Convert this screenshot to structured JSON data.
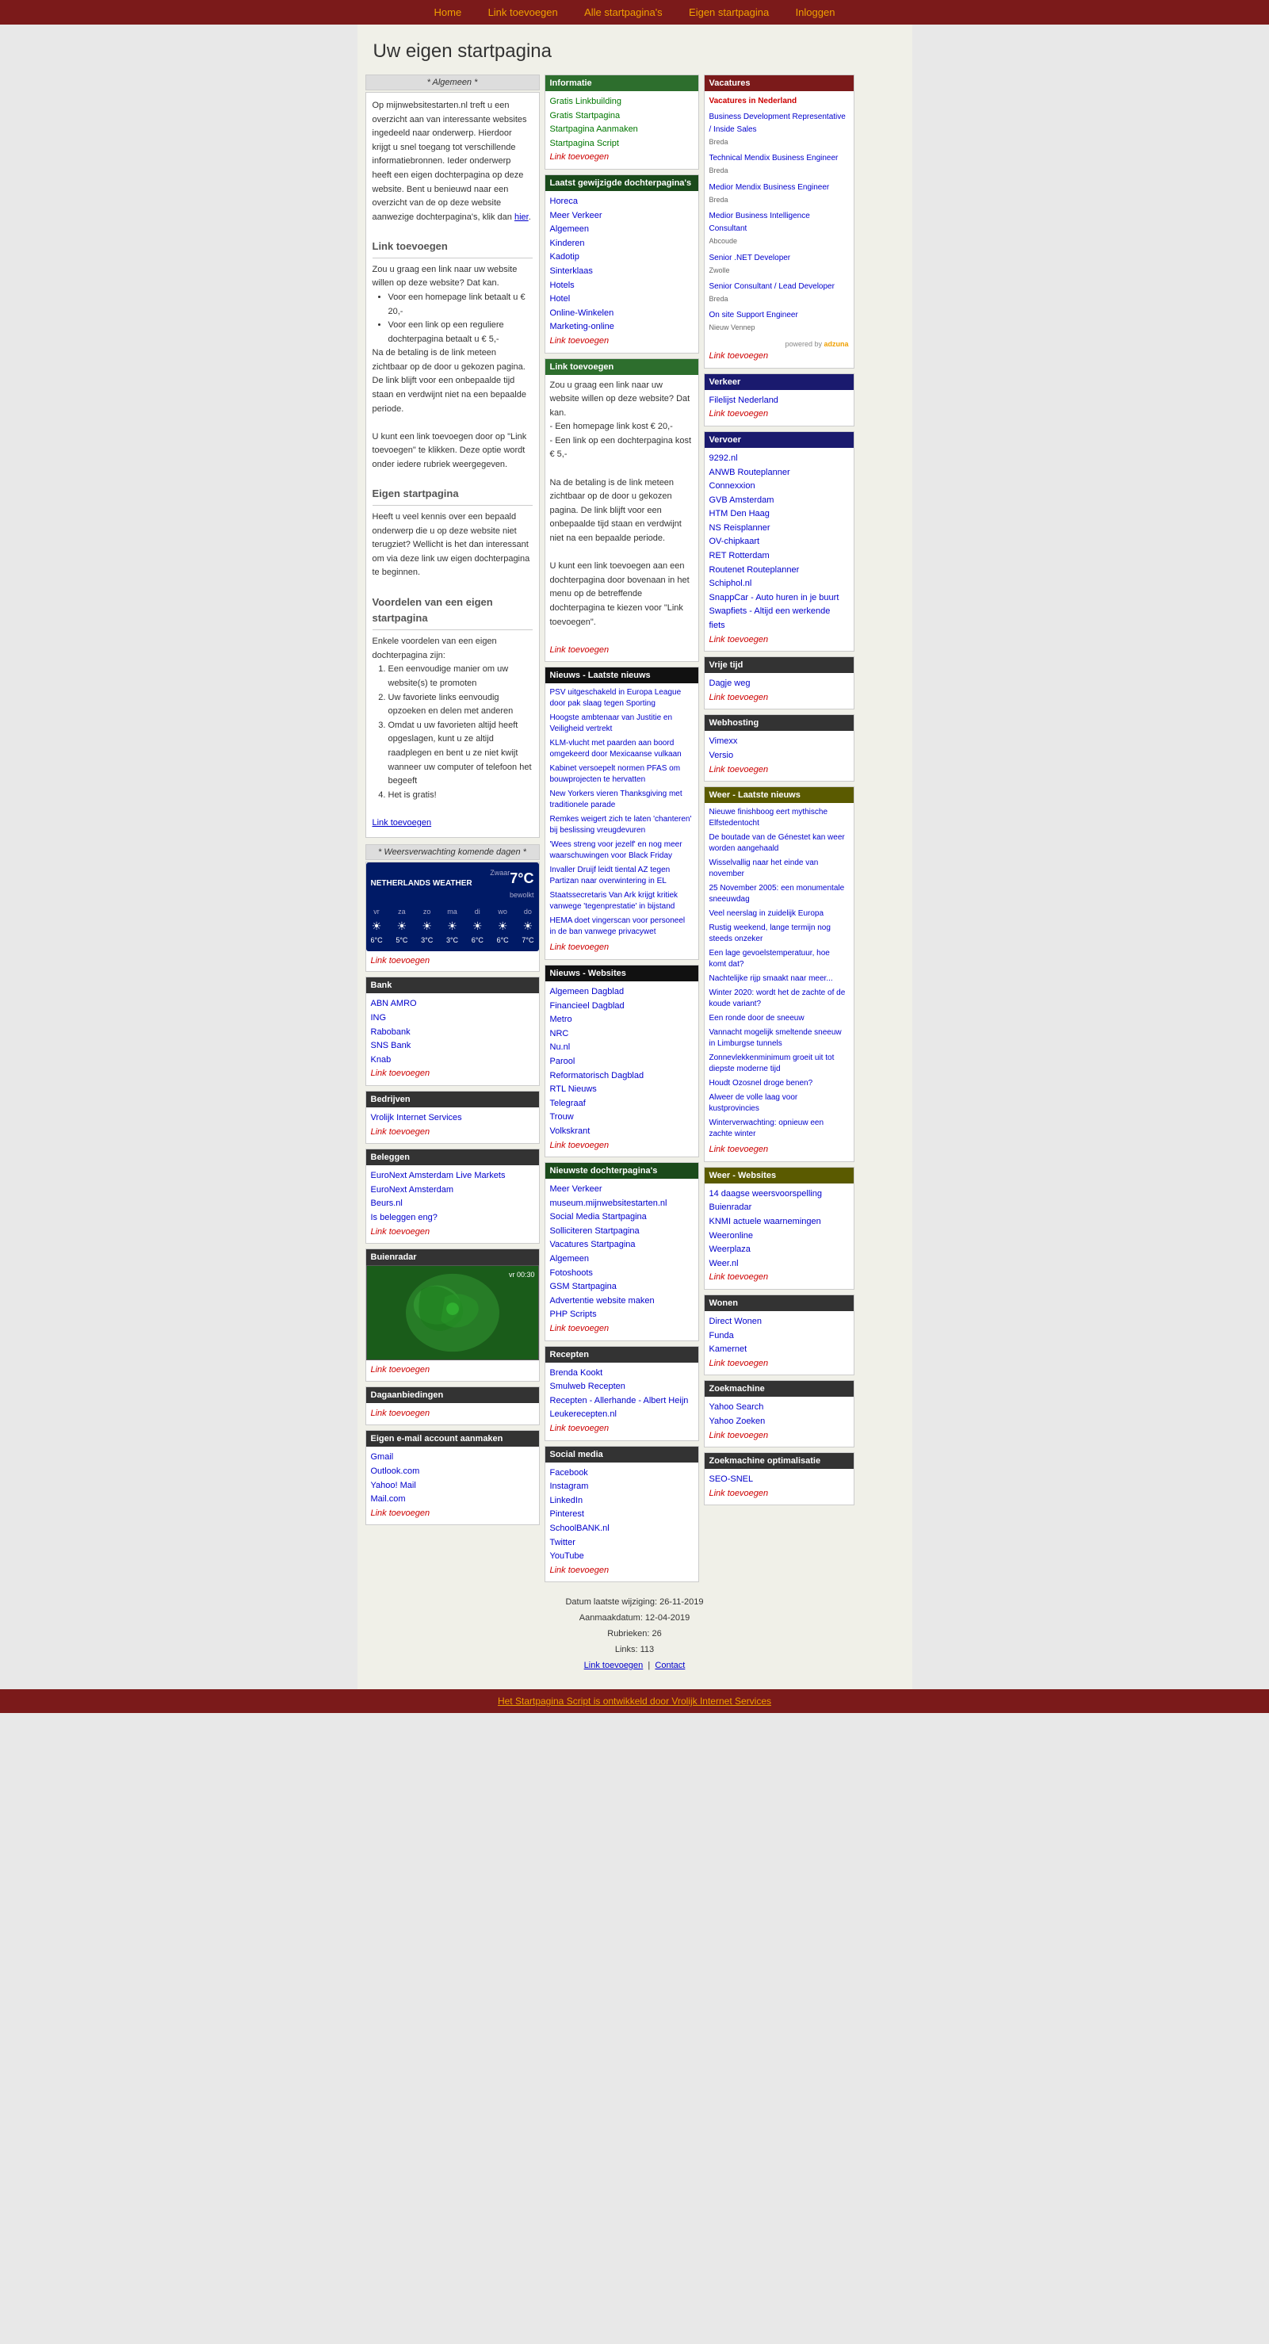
{
  "nav": {
    "items": [
      {
        "label": "Home",
        "url": "#"
      },
      {
        "label": "Link toevoegen",
        "url": "#"
      },
      {
        "label": "Alle startpagina's",
        "url": "#"
      },
      {
        "label": "Eigen startpagina",
        "url": "#"
      },
      {
        "label": "Inloggen",
        "url": "#"
      }
    ]
  },
  "page": {
    "title": "Uw eigen startpagina"
  },
  "algemeen": {
    "header": "* Algemeen *",
    "body1": "Op mijnwebsitestarten.nl treft u een overzicht aan van interessante websites ingedeeld naar onderwerp. Hierdoor krijgt u snel toegang tot verschillende informatiebronnen. Ieder onderwerp heeft een eigen dochterpagina op deze website. Bent u benieuwd naar een overzicht van de op deze website aanwezige dochterpagina's, klik dan",
    "here_text": "hier",
    "link_toevoegen_header": "Link toevoegen",
    "link_body1": "Zou u graag een link naar uw website willen op deze website? Dat kan.",
    "bullet1": "Voor een homepage link betaalt u € 20,-",
    "bullet2": "Voor een link op een reguliere dochterpagina betaalt u € 5,-",
    "link_body2": "Na de betaling is de link meteen zichtbaar op de door u gekozen pagina. De link blijft voor een onbepaalde tijd staan en verdwijnt niet na een bepaalde periode.",
    "link_body3": "U kunt een link toevoegen door op \"Link toevoegen\" te klikken. Deze optie wordt onder iedere rubriek weergegeven.",
    "eigen_header": "Eigen startpagina",
    "eigen_body": "Heeft u veel kennis over een bepaald onderwerp die u op deze website niet terugziet? Wellicht is het dan interessant om via deze link uw eigen dochterpagina te beginnen.",
    "voordelen_header": "Voordelen van een eigen startpagina",
    "voordelen_intro": "Enkele voordelen van een eigen dochterpagina zijn:",
    "voordelen": [
      "Een eenvoudige manier om uw website(s) te promoten",
      "Uw favoriete links eenvoudig opzoeken en delen met anderen",
      "Omdat u uw favorieten altijd heeft opgeslagen, kunt u ze altijd raadplegen en bent u ze niet kwijt wanneer uw computer of telefoon het begeeft",
      "Het is gratis!"
    ],
    "link_toevoegen": "Link toevoegen"
  },
  "weer_header": "* Weersverwachting komende dagen *",
  "weather": {
    "title": "NETHERLANDS WEATHER",
    "temp": "7°C",
    "condition": "Zwaar bewolkt",
    "days": [
      {
        "name": "vr",
        "icon": "☀️",
        "temp": "6°C"
      },
      {
        "name": "za",
        "icon": "☀️",
        "temp": "5°C"
      },
      {
        "name": "zo",
        "icon": "☀️",
        "temp": "3°C"
      },
      {
        "name": "ma",
        "icon": "☀️",
        "temp": "3°C"
      },
      {
        "name": "di",
        "icon": "☀️",
        "temp": "6°C"
      },
      {
        "name": "wo",
        "icon": "☀️",
        "temp": "6°C"
      },
      {
        "name": "do",
        "icon": "☀️",
        "temp": "7°C"
      }
    ],
    "link": "Link toevoegen"
  },
  "bank": {
    "header": "Bank",
    "links": [
      "ABN AMRO",
      "ING",
      "Rabobank",
      "SNS Bank",
      "Knab"
    ],
    "link_toevoegen": "Link toevoegen"
  },
  "bedrijven": {
    "header": "Bedrijven",
    "links": [
      "Vrolijk Internet Services"
    ],
    "link_toevoegen": "Link toevoegen"
  },
  "beleggen": {
    "header": "Beleggen",
    "links": [
      "EuroNext Amsterdam Live Markets",
      "EuroNext Amsterdam",
      "Beurs.nl",
      "Is beleggen eng?"
    ],
    "link_toevoegen": "Link toevoegen"
  },
  "buienradar": {
    "header": "Buienradar",
    "time": "vr 00:30",
    "link_toevoegen": "Link toevoegen"
  },
  "dagaanbiedingen": {
    "header": "Dagaanbiedingen",
    "link_toevoegen": "Link toevoegen"
  },
  "email": {
    "header": "Eigen e-mail account aanmaken",
    "links": [
      "Gmail",
      "Outlook.com",
      "Yahoo! Mail",
      "Mail.com"
    ],
    "link_toevoegen": "Link toevoegen"
  },
  "informatie": {
    "header": "Informatie",
    "links": [
      "Gratis Linkbuilding",
      "Gratis Startpagina",
      "Startpagina Aanmaken",
      "Startpagina Script"
    ],
    "link_toevoegen": "Link toevoegen"
  },
  "dochterpaginas": {
    "header": "Laatst gewijzigde dochterpagina's",
    "links": [
      "Horeca",
      "Meer Verkeer",
      "Algemeen",
      "Kinderen",
      "Kadotip",
      "Sinterklaas",
      "Hotels",
      "Hotel",
      "Online-Winkelen",
      "Marketing-online"
    ],
    "link_toevoegen": "Link toevoegen"
  },
  "link_toevoegen_mid": {
    "header": "Link toevoegen",
    "body": "Zou u graag een link naar uw website willen op deze website? Dat kan.\n- Een homepage link kost € 20,-\n- Een link op een dochterpagina kost € 5,-",
    "body2": "Na de betaling is de link meteen zichtbaar op de door u gekozen pagina. De link blijft voor een onbepaalde tijd staan en verdwijnt niet na een bepaalde periode.",
    "body3": "U kunt een link toevoegen aan een dochterpagina door bovenaan in het menu op de betreffende dochterpagina te kiezen voor \"Link toevoegen\".",
    "link_toevoegen": "Link toevoegen"
  },
  "nieuws_laatste": {
    "header": "Nieuws - Laatste nieuws",
    "items": [
      "PSV uitgeschakeld in Europa League door pak slaag tegen Sporting",
      "Hoogste ambtenaar van Justitie en Veiligheid vertrekt",
      "KLM-vlucht met paarden aan boord omgekeerd door Mexicaanse vulkaan",
      "Kabinet versoepelt normen PFAS om bouwprojecten te hervatten",
      "New Yorkers vieren Thanksgiving met traditionele parade",
      "Remkes weigert zich te laten 'chanteren' bij beslissing vreugdevuren",
      "'Wees streng voor jezelf' en nog meer waarschuwingen voor Black Friday",
      "Invaller Druijf leidt tiental AZ tegen Partizan naar overwintering in EL",
      "Staatssecretaris Van Ark krijgt kritiek vanwege 'tegenprestatie' in bijstand",
      "HEMA doet vingerscan voor personeel in de ban vanwege privacywet"
    ],
    "link_toevoegen": "Link toevoegen"
  },
  "nieuws_websites": {
    "header": "Nieuws - Websites",
    "links": [
      "Algemeen Dagblad",
      "Financieel Dagblad",
      "Metro",
      "NRC",
      "Nu.nl",
      "Parool",
      "Reformatorisch Dagblad",
      "RTL Nieuws",
      "Telegraaf",
      "Trouw",
      "Volkskrant"
    ],
    "link_toevoegen": "Link toevoegen"
  },
  "nieuwste_dochter": {
    "header": "Nieuwste dochterpagina's",
    "links": [
      "Meer Verkeer",
      "museum.mijnwebsitestarten.nl",
      "Social Media Startpagina",
      "Solliciteren Startpagina",
      "Vacatures Startpagina",
      "Algemeen",
      "Fotoshoots",
      "GSM Startpagina",
      "Advertentie website maken",
      "PHP Scripts"
    ],
    "link_toevoegen": "Link toevoegen"
  },
  "recepten": {
    "header": "Recepten",
    "links": [
      "Brenda Kookt",
      "Smulweb Recepten",
      "Recepten - Allerhande - Albert Heijn",
      "Leukerecepten.nl"
    ],
    "link_toevoegen": "Link toevoegen"
  },
  "social_media": {
    "header": "Social media",
    "links": [
      "Facebook",
      "Instagram",
      "LinkedIn",
      "Pinterest",
      "SchoolBANK.nl",
      "Twitter",
      "YouTube"
    ],
    "link_toevoegen": "Link toevoegen"
  },
  "vacatures": {
    "header": "Vacatures",
    "title": "Vacatures in Nederland",
    "jobs": [
      {
        "title": "Business Development Representative / Inside Sales",
        "location": "Breda"
      },
      {
        "title": "Technical Mendix Business Engineer",
        "location": "Breda"
      },
      {
        "title": "Medior Mendix Business Engineer",
        "location": "Breda"
      },
      {
        "title": "Medior Business Intelligence Consultant",
        "location": "Abcoude"
      },
      {
        "title": "Senior .NET Developer",
        "location": "Zwolle"
      },
      {
        "title": "Senior Consultant / Lead Developer",
        "location": "Breda"
      },
      {
        "title": "On site Support Engineer",
        "location": "Nieuw Vennep"
      }
    ],
    "powered_by": "powered by",
    "adzuna": "adzuna",
    "link_toevoegen": "Link toevoegen"
  },
  "verkeer": {
    "header": "Verkeer",
    "links": [
      "Filelijst Nederland"
    ],
    "link_toevoegen": "Link toevoegen"
  },
  "vervoer": {
    "header": "Vervoer",
    "links": [
      "9292.nl",
      "ANWB Routeplanner",
      "Connexxion",
      "GVB Amsterdam",
      "HTM Den Haag",
      "NS Reisplanner",
      "OV-chipkaart",
      "RET Rotterdam",
      "Routenet Routeplanner",
      "Schiphol.nl",
      "SnappCar - Auto huren in je buurt",
      "Swapfiets - Altijd een werkende fiets"
    ],
    "link_toevoegen": "Link toevoegen"
  },
  "vrije_tijd": {
    "header": "Vrije tijd",
    "links": [
      "Dagje weg"
    ],
    "link_toevoegen": "Link toevoegen"
  },
  "webhosting": {
    "header": "Webhosting",
    "links": [
      "Vimexx",
      "Versio"
    ],
    "link_toevoegen": "Link toevoegen"
  },
  "weer_laatste": {
    "header": "Weer - Laatste nieuws",
    "items": [
      "Nieuwe finishboog eert mythische Elfstedentocht",
      "De boutade van de Génestet kan weer worden aangehaald",
      "Wisselvallig naar het einde van november",
      "25 November 2005: een monumentale sneeuwdag",
      "Veel neerslag in zuidelijk Europa",
      "Rustig weekend, lange termijn nog steeds onzeker",
      "Een lage gevoelstemperatuur, hoe komt dat?",
      "Nachtelijke rijp smaakt naar meer...",
      "Winter 2020: wordt het de zachte of de koude variant?",
      "Een ronde door de sneeuw",
      "Vannacht mogelijk smeltende sneeuw in Limburgse tunnels",
      "Zonnevlekkenminimum groeit uit tot diepste moderne tijd",
      "Houdt Ozosnel droge benen?",
      "Alweer de volle laag voor kustprovincies",
      "Winterverwachting: opnieuw een zachte winter"
    ],
    "link_toevoegen": "Link toevoegen"
  },
  "weer_websites": {
    "header": "Weer - Websites",
    "links": [
      "14 daagse weersvoorspelling",
      "Buienradar",
      "KNMI actuele waarnemingen",
      "Weeronline",
      "Weerplaza",
      "Weer.nl"
    ],
    "link_toevoegen": "Link toevoegen"
  },
  "wonen": {
    "header": "Wonen",
    "links": [
      "Direct Wonen",
      "Funda",
      "Kamernet"
    ],
    "link_toevoegen": "Link toevoegen"
  },
  "zoekmachine": {
    "header": "Zoekmachine",
    "links": [
      "Yahoo Search",
      "Yahoo Zoeken"
    ],
    "link_toevoegen": "Link toevoegen"
  },
  "zoekmachine_opt": {
    "header": "Zoekmachine optimalisatie",
    "links": [
      "SEO-SNEL"
    ],
    "link_toevoegen": "Link toevoegen"
  },
  "footer": {
    "datum": "Datum laatste wijziging: 26-11-2019",
    "aanmaak": "Aanmaakdatum: 12-04-2019",
    "rubrieken": "Rubrieken: 26",
    "links": "Links: 113",
    "link_toevoegen": "Link toevoegen",
    "contact": "Contact"
  },
  "bottom_footer": {
    "text": "Het Startpagina Script is ontwikkeld door Vrolijk Internet Services"
  }
}
